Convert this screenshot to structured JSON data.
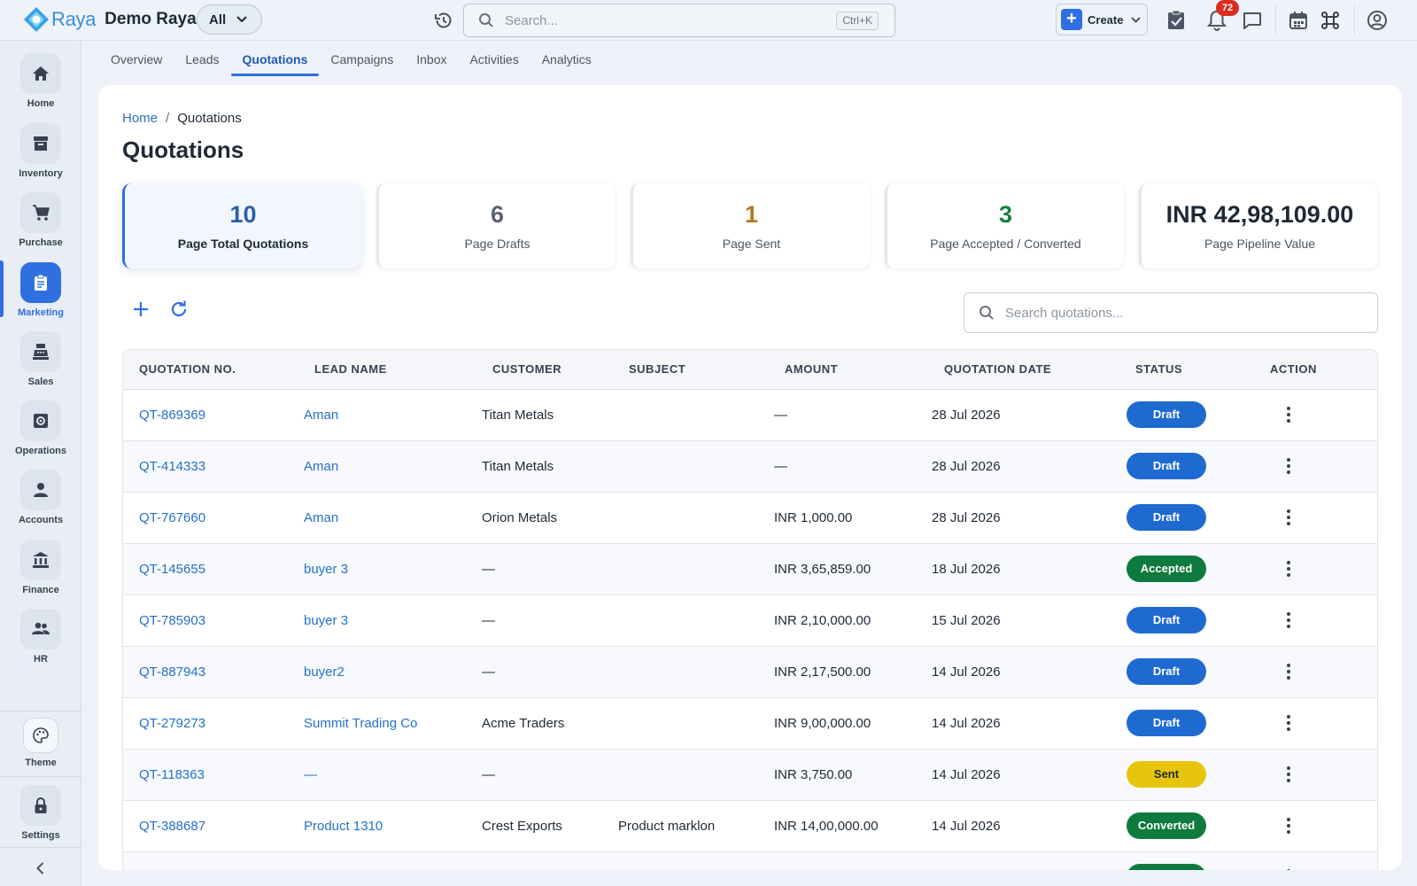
{
  "app": {
    "brand_name": "Raya",
    "company": "Demo Raya",
    "scope_filter": "All",
    "search_placeholder": "Search...",
    "search_shortcut": "Ctrl+K",
    "create_label": "Create",
    "notification_count": "72",
    "accent_color": "#2f6fe0"
  },
  "sidebar": {
    "items": [
      {
        "label": "Home",
        "icon": "home-icon"
      },
      {
        "label": "Inventory",
        "icon": "archive-icon"
      },
      {
        "label": "Purchase",
        "icon": "cart-icon"
      },
      {
        "label": "Marketing",
        "icon": "clipboard-icon",
        "active": true
      },
      {
        "label": "Sales",
        "icon": "register-icon"
      },
      {
        "label": "Operations",
        "icon": "settings-box-icon"
      },
      {
        "label": "Accounts",
        "icon": "person-icon"
      },
      {
        "label": "Finance",
        "icon": "bank-icon"
      },
      {
        "label": "HR",
        "icon": "people-icon"
      }
    ],
    "theme_label": "Theme",
    "settings_label": "Settings"
  },
  "tabs": [
    {
      "label": "Overview"
    },
    {
      "label": "Leads"
    },
    {
      "label": "Quotations",
      "active": true
    },
    {
      "label": "Campaigns"
    },
    {
      "label": "Inbox"
    },
    {
      "label": "Activities"
    },
    {
      "label": "Analytics"
    }
  ],
  "breadcrumb": {
    "home": "Home",
    "separator": "/",
    "current": "Quotations"
  },
  "page_title": "Quotations",
  "stats": [
    {
      "value": "10",
      "label": "Page Total Quotations",
      "color": "#2a5ea8"
    },
    {
      "value": "6",
      "label": "Page Drafts",
      "color": "#5b6472"
    },
    {
      "value": "1",
      "label": "Page Sent",
      "color": "#b7791f"
    },
    {
      "value": "3",
      "label": "Page Accepted / Converted",
      "color": "#17803d"
    },
    {
      "value": "INR 42,98,109.00",
      "label": "Page Pipeline Value",
      "color": "#1f2937"
    }
  ],
  "table": {
    "search_placeholder": "Search quotations...",
    "columns": [
      "QUOTATION NO.",
      "LEAD NAME",
      "CUSTOMER",
      "SUBJECT",
      "AMOUNT",
      "QUOTATION DATE",
      "STATUS",
      "ACTION"
    ],
    "rows": [
      {
        "no": "QT-869369",
        "lead": "Aman",
        "customer": "Titan Metals",
        "subject": "",
        "amount": "—",
        "date": "28 Jul 2026",
        "status": "Draft"
      },
      {
        "no": "QT-414333",
        "lead": "Aman",
        "customer": "Titan Metals",
        "subject": "",
        "amount": "—",
        "date": "28 Jul 2026",
        "status": "Draft"
      },
      {
        "no": "QT-767660",
        "lead": "Aman",
        "customer": "Orion Metals",
        "subject": "",
        "amount": "INR 1,000.00",
        "date": "28 Jul 2026",
        "status": "Draft"
      },
      {
        "no": "QT-145655",
        "lead": "buyer 3",
        "customer": "—",
        "subject": "",
        "amount": "INR 3,65,859.00",
        "date": "18 Jul 2026",
        "status": "Accepted"
      },
      {
        "no": "QT-785903",
        "lead": "buyer 3",
        "customer": "—",
        "subject": "",
        "amount": "INR 2,10,000.00",
        "date": "15 Jul 2026",
        "status": "Draft"
      },
      {
        "no": "QT-887943",
        "lead": "buyer2",
        "customer": "—",
        "subject": "",
        "amount": "INR 2,17,500.00",
        "date": "14 Jul 2026",
        "status": "Draft"
      },
      {
        "no": "QT-279273",
        "lead": "Summit Trading Co",
        "customer": "Acme Traders",
        "subject": "",
        "amount": "INR 9,00,000.00",
        "date": "14 Jul 2026",
        "status": "Draft"
      },
      {
        "no": "QT-118363",
        "lead": "—",
        "customer": "—",
        "subject": "",
        "amount": "INR 3,750.00",
        "date": "14 Jul 2026",
        "status": "Sent"
      },
      {
        "no": "QT-388687",
        "lead": "Product 1310",
        "customer": "Crest Exports",
        "subject": "Product marklon",
        "amount": "INR 14,00,000.00",
        "date": "14 Jul 2026",
        "status": "Converted"
      },
      {
        "no": "",
        "lead": "",
        "customer": "",
        "subject": "",
        "amount": "",
        "date": "",
        "status": "Converted"
      }
    ]
  }
}
